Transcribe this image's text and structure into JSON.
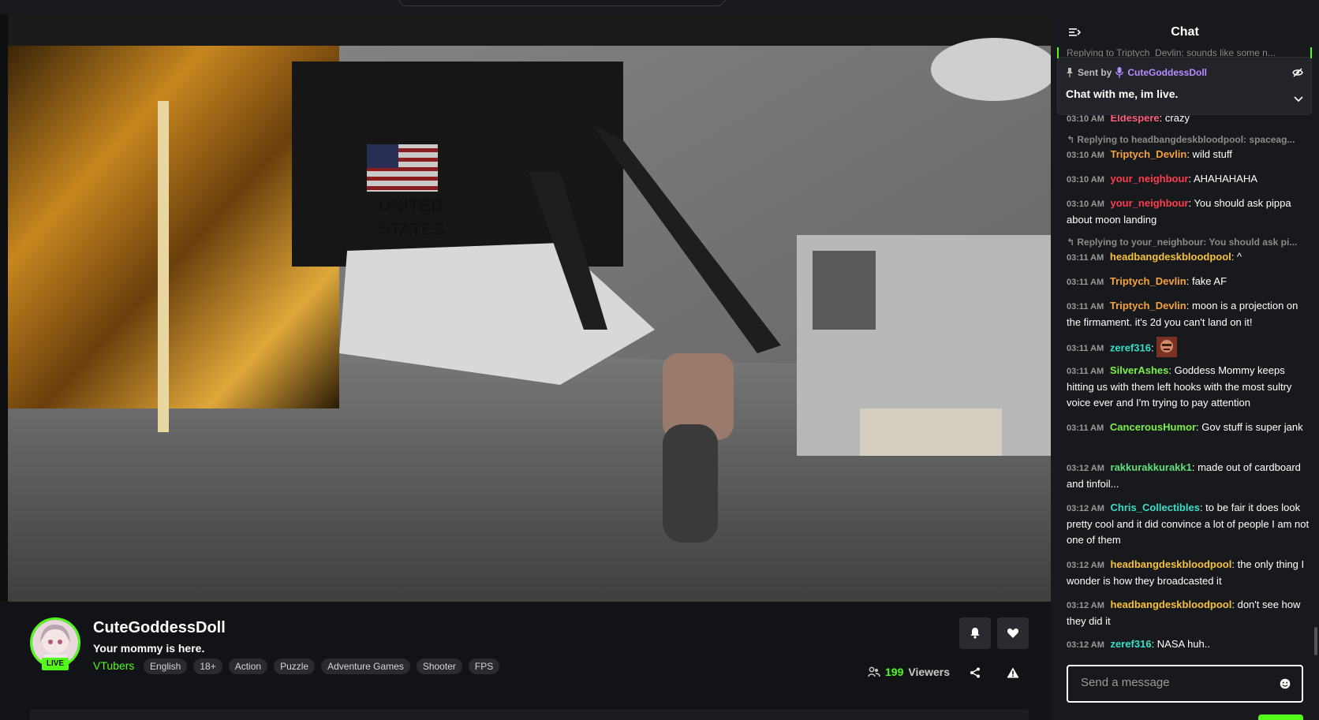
{
  "colors": {
    "accent": "#53fc18",
    "bg": "#0e0f11",
    "chat_bg": "#18191c"
  },
  "stream": {
    "channel_name": "CuteGoddessDoll",
    "title": "Your mommy is here.",
    "live_label": "LIVE",
    "category": "VTubers",
    "tags": [
      "English",
      "18+",
      "Action",
      "Puzzle",
      "Adventure Games",
      "Shooter",
      "FPS"
    ],
    "viewer_count": "199",
    "viewer_label": "Viewers"
  },
  "chat": {
    "title": "Chat",
    "pinned_reply_preview": "Replying to Triptych_Devlin: sounds like some n...",
    "pinned": {
      "sent_by_label": "Sent by",
      "sender": "CuteGoddessDoll",
      "message": "Chat with me, im live."
    },
    "messages": [
      {
        "time": "03:10 AM",
        "user": "Eldespere",
        "color": "#ff5c7a",
        "text": ": crazy"
      },
      {
        "reply": "Replying to headbangdeskbloodpool: spaceag..."
      },
      {
        "time": "03:10 AM",
        "user": "Triptych_Devlin",
        "color": "#f7a23b",
        "text": ": wild stuff"
      },
      {
        "time": "03:10 AM",
        "user": "your_neighbour",
        "color": "#ff3b4e",
        "text": ": AHAHAHAHA"
      },
      {
        "time": "03:10 AM",
        "user": "your_neighbour",
        "color": "#ff3b4e",
        "text": ": You should ask pippa about moon landing"
      },
      {
        "reply": "Replying to your_neighbour: You should ask pi..."
      },
      {
        "time": "03:11 AM",
        "user": "headbangdeskbloodpool",
        "color": "#f7c23b",
        "text": ": ^"
      },
      {
        "time": "03:11 AM",
        "user": "Triptych_Devlin",
        "color": "#f7a23b",
        "text": ": fake AF"
      },
      {
        "time": "03:11 AM",
        "user": "Triptych_Devlin",
        "color": "#f7a23b",
        "text": ": moon is a projection on the firmament. it's 2d you can't land on it!"
      },
      {
        "time": "03:11 AM",
        "user": "zeref316",
        "color": "#35e0c8",
        "text": ":"
      },
      {
        "time": "03:11 AM",
        "user": "SilverAshes",
        "color": "#7cf04a",
        "text": ": Goddess Mommy keeps hitting us with them left hooks with the most sultry voice ever and I'm trying to pay attention"
      },
      {
        "time": "03:11 AM",
        "user": "CancerousHumor",
        "color": "#7cf04a",
        "text": ": Gov stuff is super jank"
      },
      {
        "time": "03:12 AM",
        "user": "rakkurakkurakk1",
        "color": "#5fe07a",
        "text": ": made out of cardboard and tinfoil..."
      },
      {
        "time": "03:12 AM",
        "user": "Chris_Collectibles",
        "color": "#35e0c8",
        "text": ": to be fair it does look pretty cool and it did convince a lot of people I am not one of them"
      },
      {
        "time": "03:12 AM",
        "user": "headbangdeskbloodpool",
        "color": "#f7c23b",
        "text": ": the only thing I wonder is how they broadcasted it"
      },
      {
        "time": "03:12 AM",
        "user": "headbangdeskbloodpool",
        "color": "#f7c23b",
        "text": ": don't see how they did it"
      },
      {
        "time": "03:12 AM",
        "user": "zeref316",
        "color": "#35e0c8",
        "text": ": NASA huh.."
      }
    ],
    "input_placeholder": "Send a message"
  },
  "icons": {
    "notify": "bell-icon",
    "follow": "heart-icon",
    "share": "share-icon",
    "report": "warning-icon",
    "viewers": "users-icon",
    "collapse": "collapse-chat-icon",
    "pin": "pin-icon",
    "mic": "microphone-icon",
    "hide": "eye-off-icon",
    "expand": "chevron-down-icon",
    "emoji": "emoji-icon"
  }
}
